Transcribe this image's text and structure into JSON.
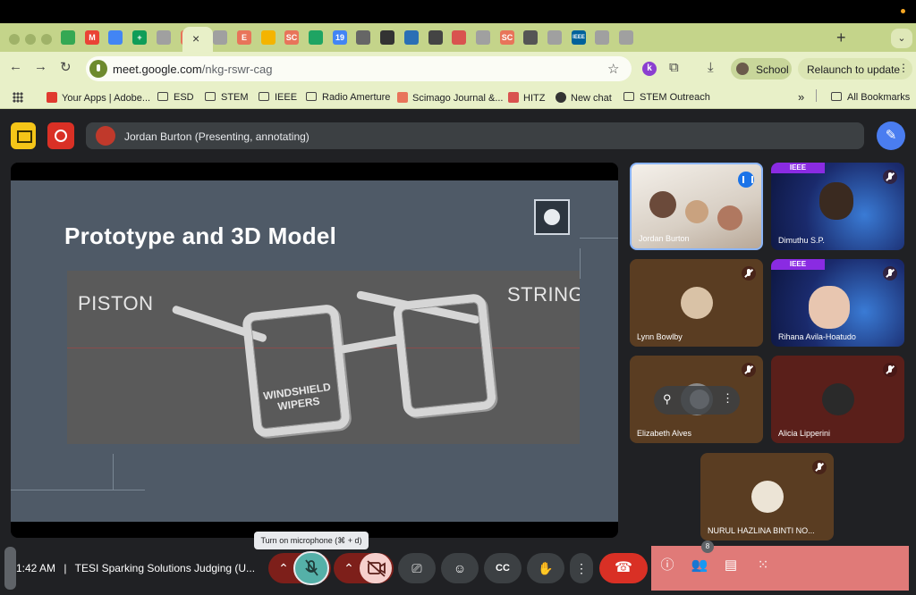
{
  "browser": {
    "active_tab_close": "×",
    "new_tab": "+",
    "url_host": "meet.google.com",
    "url_path": "/nkg-rswr-cag",
    "profile_label": "School",
    "relaunch_label": "Relaunch to update",
    "tab_favicons": [
      {
        "glyph": "",
        "color": "#34a853"
      },
      {
        "glyph": "M",
        "color": "#ea4335"
      },
      {
        "glyph": "",
        "color": "#4285f4"
      },
      {
        "glyph": "+",
        "color": "#0f9d58"
      },
      {
        "glyph": "",
        "color": "#a0a0a0"
      },
      {
        "glyph": "SJR",
        "color": "#e8745a"
      },
      {
        "glyph": "",
        "color": "#a0a0a0"
      },
      {
        "glyph": "E",
        "color": "#e8745a"
      },
      {
        "glyph": "",
        "color": "#f4b400"
      },
      {
        "glyph": "SC",
        "color": "#e8745a"
      },
      {
        "glyph": "",
        "color": "#1fa463"
      },
      {
        "glyph": "19",
        "color": "#4285f4"
      },
      {
        "glyph": "",
        "color": "#666666"
      },
      {
        "glyph": "",
        "color": "#333333"
      },
      {
        "glyph": "",
        "color": "#2a6fb5"
      },
      {
        "glyph": "",
        "color": "#444444"
      },
      {
        "glyph": "",
        "color": "#d9534f"
      },
      {
        "glyph": "",
        "color": "#a0a0a0"
      },
      {
        "glyph": "SC",
        "color": "#e8745a"
      },
      {
        "glyph": "",
        "color": "#555555"
      },
      {
        "glyph": "",
        "color": "#a0a0a0"
      },
      {
        "glyph": "IEEE",
        "color": "#00629b"
      },
      {
        "glyph": "",
        "color": "#a0a0a0"
      },
      {
        "glyph": "",
        "color": "#a0a0a0"
      }
    ]
  },
  "bookmarks": {
    "items": [
      "Your Apps | Adobe...",
      "ESD",
      "STEM",
      "IEEE",
      "Radio Amerture",
      "Scimago Journal &...",
      "HITZ",
      "New chat",
      "STEM Outreach"
    ],
    "more": "»",
    "all": "All Bookmarks"
  },
  "meet": {
    "presenter_bar": "Jordan Burton (Presenting, annotating)",
    "slide": {
      "title": "Prototype and 3D Model",
      "labels": {
        "piston": "PISTON",
        "string": "STRING",
        "wipers": "WINDSHIELD WIPERS"
      }
    },
    "participants": [
      {
        "name": "Jordan Burton",
        "status": "speaking"
      },
      {
        "name": "Dimuthu S.P.",
        "status": "muted",
        "badge": "IEEE"
      },
      {
        "name": "Lynn Bowlby",
        "status": "muted"
      },
      {
        "name": "Rihana Avila-Hoatudo",
        "status": "muted",
        "badge": "IEEE"
      },
      {
        "name": "Elizabeth Alves",
        "status": "muted"
      },
      {
        "name": "Alicia Lipperini",
        "status": "muted"
      },
      {
        "name": "NURUL HAZLINA BINTI NO...",
        "status": "muted"
      }
    ],
    "bottom": {
      "time": "1:42 AM",
      "separator": "|",
      "meeting_title": "TESI Sparking Solutions Judging (U...",
      "tooltip": "Turn on microphone (⌘ + d)",
      "people_count": "8"
    }
  }
}
